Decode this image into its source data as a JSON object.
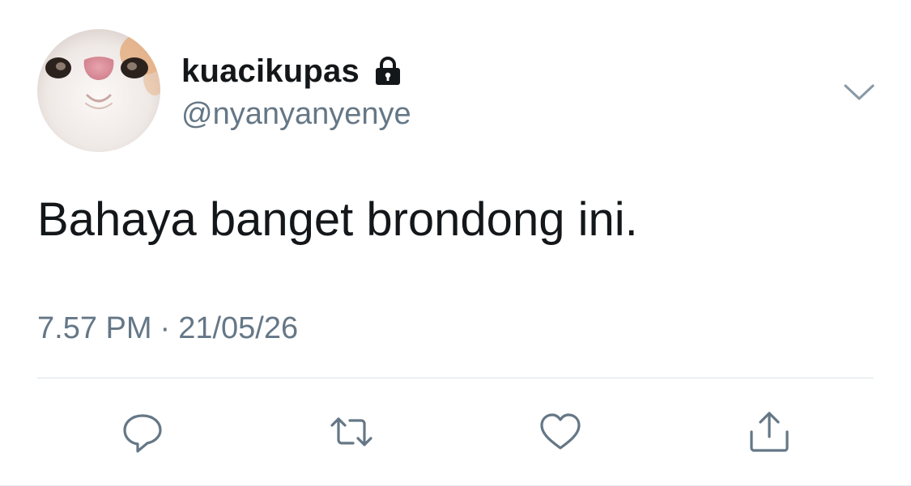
{
  "tweet": {
    "display_name": "kuacikupas",
    "handle": "@nyanyanyenye",
    "text": "Bahaya banget brondong ini.",
    "time": "7.57 PM",
    "separator": "·",
    "date": "21/05/26",
    "protected_icon": "lock-icon",
    "menu_icon": "chevron-down-icon"
  },
  "actions": [
    {
      "name": "reply",
      "icon": "speech-bubble-icon"
    },
    {
      "name": "retweet",
      "icon": "retweet-arrows-icon"
    },
    {
      "name": "like",
      "icon": "heart-icon"
    },
    {
      "name": "share",
      "icon": "share-upload-icon"
    }
  ],
  "colors": {
    "text": "#14171a",
    "secondary": "#657786",
    "icon": "#657786",
    "divider": "#dde3e8"
  }
}
